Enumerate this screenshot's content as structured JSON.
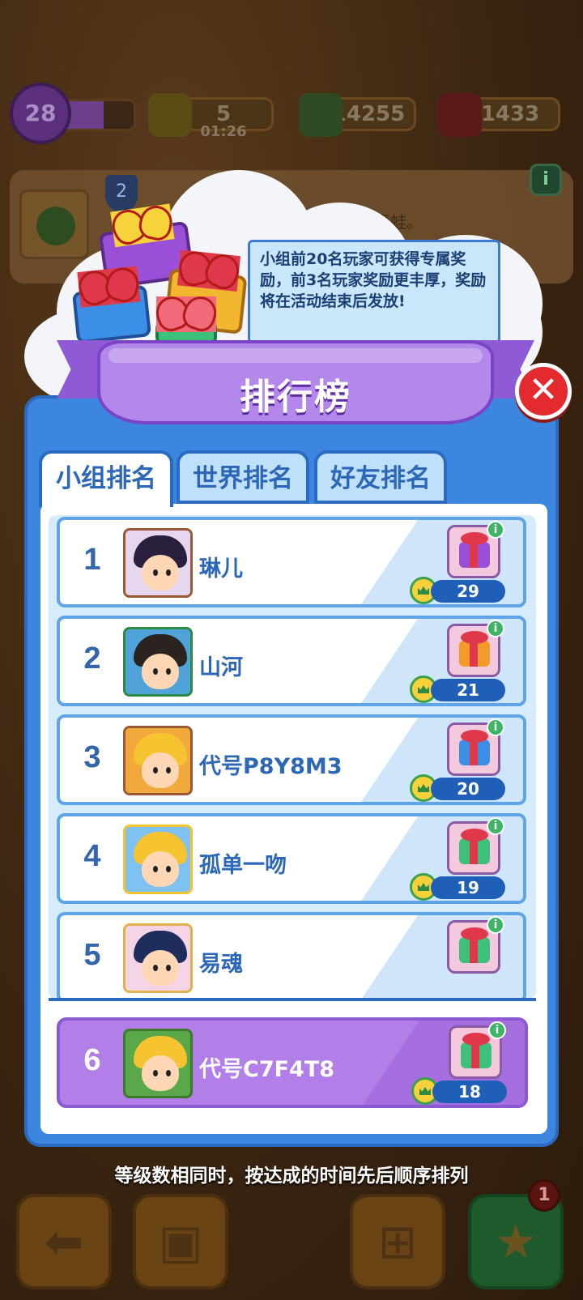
{
  "hud": {
    "level": "28",
    "energy": "5",
    "energy_timer": "01:26",
    "cash": "14255",
    "gems": "1433"
  },
  "bg_hint": "请合成得到小青蛙。",
  "bg_shield": "2",
  "tooltip": "小组前20名玩家可获得专属奖励，前3名玩家奖励更丰厚，奖励将在活动结束后发放!",
  "panel": {
    "title": "排行榜",
    "close_symbol": "✕",
    "tabs": [
      {
        "label": "小组排名",
        "active": true
      },
      {
        "label": "世界排名",
        "active": false
      },
      {
        "label": "好友排名",
        "active": false
      }
    ]
  },
  "leaderboard": [
    {
      "rank": "1",
      "name": "琳儿",
      "score": "29",
      "gift_color": "#9b4fd6"
    },
    {
      "rank": "2",
      "name": "山河",
      "score": "21",
      "gift_color": "#f39a2c"
    },
    {
      "rank": "3",
      "name": "代号P8Y8M3",
      "score": "20",
      "gift_color": "#3c8fe6"
    },
    {
      "rank": "4",
      "name": "孤单一吻",
      "score": "19",
      "gift_color": "#3cc07a"
    },
    {
      "rank": "5",
      "name": "易魂",
      "score": "",
      "gift_color": "#3cc07a"
    }
  ],
  "me": {
    "rank": "6",
    "name": "代号C7F4T8",
    "score": "18",
    "gift_color": "#3cc07a"
  },
  "info_symbol": "i",
  "footer_note": "等级数相同时，按达成的时间先后顺序排列",
  "bottom": {
    "badge": "1"
  }
}
